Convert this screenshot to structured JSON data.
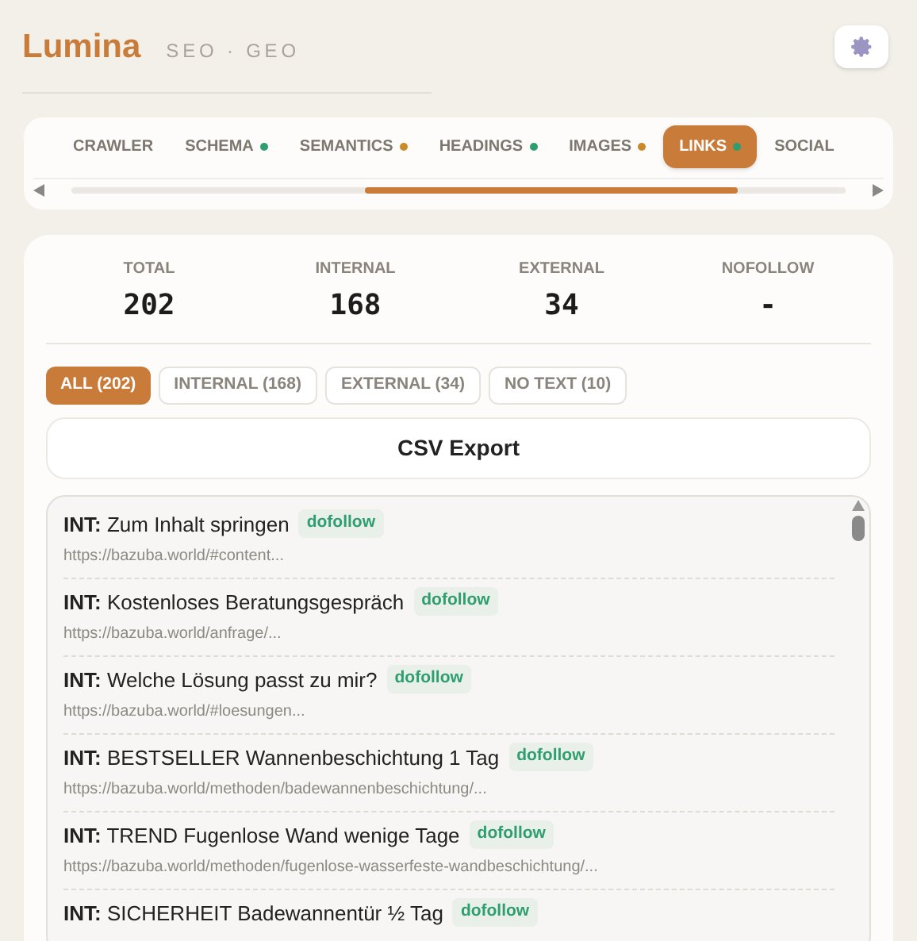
{
  "header": {
    "logo": "Lumina",
    "subtitle": "SEO · GEO"
  },
  "tabs": [
    {
      "label": "CRAWLER",
      "selected": false
    },
    {
      "label": "SCHEMA",
      "selected": false,
      "color": "#2e9e6e"
    },
    {
      "label": "SEMANTICS",
      "selected": false,
      "color": "#c98a2a"
    },
    {
      "label": "HEADINGS",
      "selected": false,
      "color": "#2e9e6e"
    },
    {
      "label": "IMAGES",
      "selected": false,
      "color": "#c98a2a"
    },
    {
      "label": "LINKS",
      "selected": true,
      "color": "#2e9e6e"
    },
    {
      "label": "SOCIAL",
      "selected": false
    }
  ],
  "stats": [
    {
      "label": "TOTAL",
      "value": "202"
    },
    {
      "label": "INTERNAL",
      "value": "168"
    },
    {
      "label": "EXTERNAL",
      "value": "34"
    },
    {
      "label": "NOFOLLOW",
      "value": "-"
    }
  ],
  "filters": [
    {
      "label": "ALL (202)",
      "selected": true
    },
    {
      "label": "INTERNAL (168)",
      "selected": false
    },
    {
      "label": "EXTERNAL (34)",
      "selected": false
    },
    {
      "label": "NO TEXT (10)",
      "selected": false
    }
  ],
  "export_button": "CSV Export",
  "links": [
    {
      "type": "INT:",
      "text": "Zum Inhalt springen",
      "badge": "dofollow",
      "url": "https://bazuba.world/#content..."
    },
    {
      "type": "INT:",
      "text": "Kostenloses Beratungsgespräch",
      "badge": "dofollow",
      "url": "https://bazuba.world/anfrage/..."
    },
    {
      "type": "INT:",
      "text": "Welche Lösung passt zu mir?",
      "badge": "dofollow",
      "url": "https://bazuba.world/#loesungen..."
    },
    {
      "type": "INT:",
      "text": "BESTSELLER Wannenbeschichtung 1 Tag",
      "badge": "dofollow",
      "url": "https://bazuba.world/methoden/badewannenbeschichtung/..."
    },
    {
      "type": "INT:",
      "text": "TREND Fugenlose Wand wenige Tage",
      "badge": "dofollow",
      "url": "https://bazuba.world/methoden/fugenlose-wasserfeste-wandbeschichtung/..."
    },
    {
      "type": "INT:",
      "text": "SICHERHEIT Badewannentür ½ Tag",
      "badge": "dofollow"
    }
  ]
}
